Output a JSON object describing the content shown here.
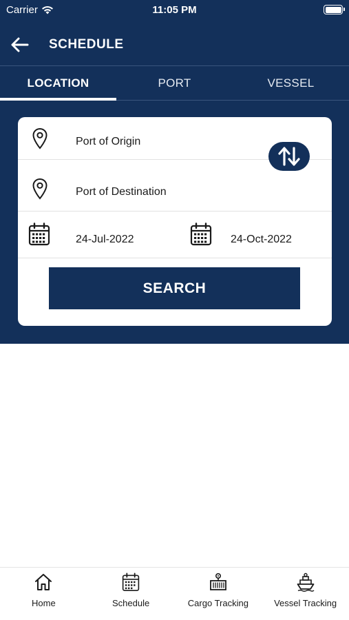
{
  "status_bar": {
    "carrier": "Carrier",
    "time": "11:05 PM"
  },
  "header": {
    "title": "SCHEDULE"
  },
  "tabs": [
    {
      "label": "LOCATION",
      "active": true
    },
    {
      "label": "PORT",
      "active": false
    },
    {
      "label": "VESSEL",
      "active": false
    }
  ],
  "form": {
    "origin_label": "Port of Origin",
    "destination_label": "Port of Destination",
    "from_date": "24-Jul-2022",
    "to_date": "24-Oct-2022",
    "search_label": "SEARCH"
  },
  "bottom_nav": [
    {
      "label": "Home",
      "icon": "home-icon"
    },
    {
      "label": "Schedule",
      "icon": "calendar-icon"
    },
    {
      "label": "Cargo Tracking",
      "icon": "container-icon"
    },
    {
      "label": "Vessel Tracking",
      "icon": "ship-icon"
    }
  ],
  "colors": {
    "primary": "#13305a",
    "surface": "#ffffff"
  }
}
